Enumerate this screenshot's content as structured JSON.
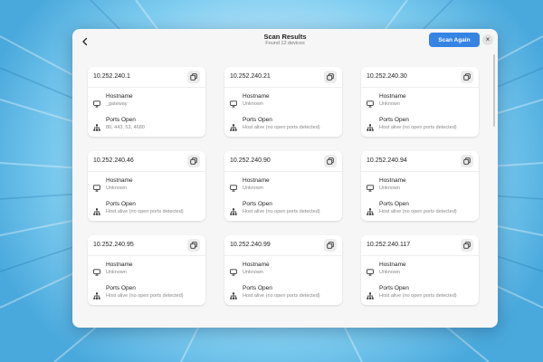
{
  "header": {
    "title": "Scan Results",
    "subtitle": "Found 12 devices",
    "scan_again_label": "Scan Again",
    "close_label": "×"
  },
  "labels": {
    "hostname": "Hostname",
    "ports": "Ports Open"
  },
  "devices": [
    {
      "ip": "10.252.240.1",
      "hostname": "_gateway",
      "ports": "80, 443, 53, 4680"
    },
    {
      "ip": "10.252.240.21",
      "hostname": "Unknown",
      "ports": "Host alive (no open ports detected)"
    },
    {
      "ip": "10.252.240.30",
      "hostname": "Unknown",
      "ports": "Host alive (no open ports detected)"
    },
    {
      "ip": "10.252.240.46",
      "hostname": "Unknown",
      "ports": "Host alive (no open ports detected)"
    },
    {
      "ip": "10.252.240.90",
      "hostname": "Unknown",
      "ports": "Host alive (no open ports detected)"
    },
    {
      "ip": "10.252.240.94",
      "hostname": "Unknown",
      "ports": "Host alive (no open ports detected)"
    },
    {
      "ip": "10.252.240.95",
      "hostname": "Unknown",
      "ports": "Host alive (no open ports detected)"
    },
    {
      "ip": "10.252.240.99",
      "hostname": "Unknown",
      "ports": "Host alive (no open ports detected)"
    },
    {
      "ip": "10.252.240.117",
      "hostname": "Unknown",
      "ports": "Host alive (no open ports detected)"
    }
  ],
  "icons": {
    "back": "arrow-left-icon",
    "copy": "copy-icon",
    "hostname": "monitor-icon",
    "ports": "network-icon",
    "close": "close-icon"
  },
  "colors": {
    "accent": "#3584e4"
  }
}
